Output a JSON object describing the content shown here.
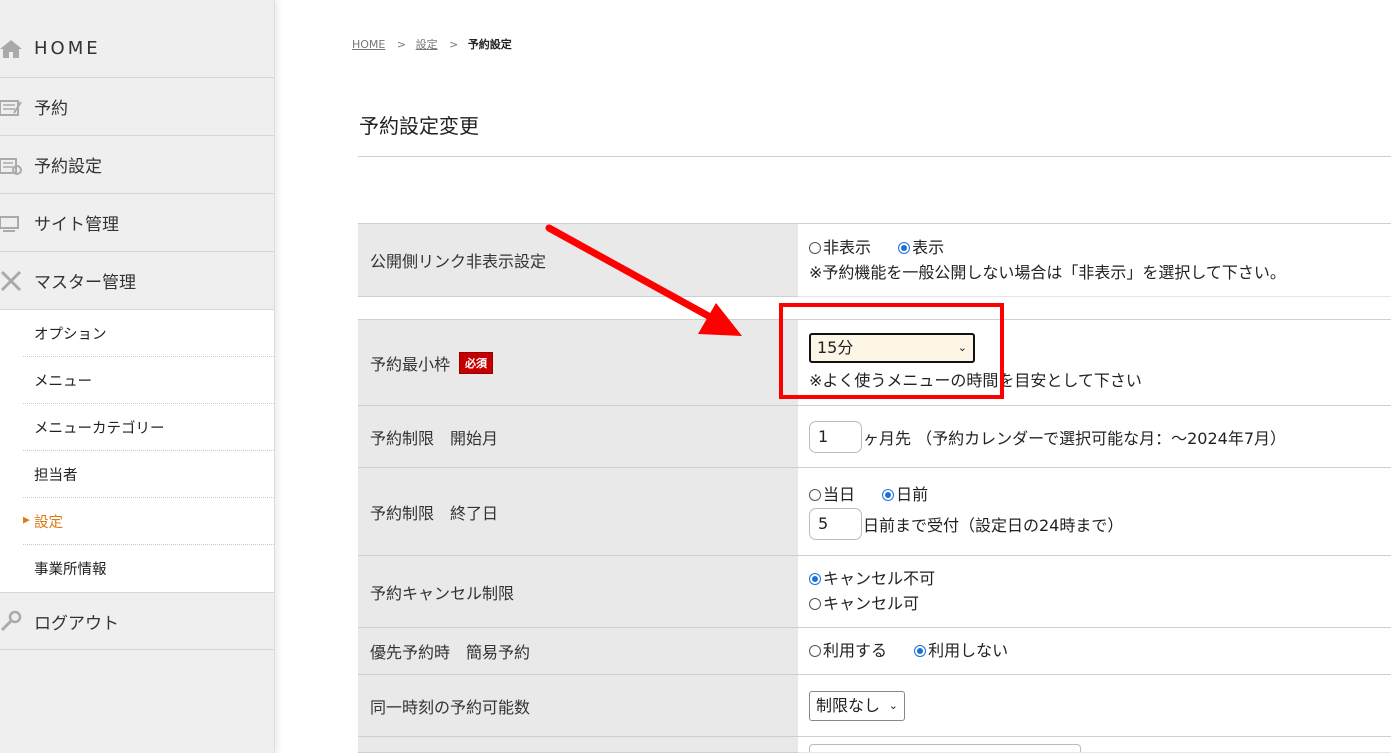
{
  "sidebar": {
    "home": "HOME",
    "items": [
      {
        "label": "予約"
      },
      {
        "label": "予約設定"
      },
      {
        "label": "サイト管理"
      },
      {
        "label": "マスター管理"
      }
    ],
    "submenu": [
      {
        "label": "オプション"
      },
      {
        "label": "メニュー"
      },
      {
        "label": "メニューカテゴリー"
      },
      {
        "label": "担当者"
      },
      {
        "label": "設定"
      },
      {
        "label": "事業所情報"
      }
    ],
    "logout": "ログアウト"
  },
  "breadcrumb": {
    "home": "HOME",
    "sep": ">",
    "settings": "設定",
    "current": "予約設定"
  },
  "page_title": "予約設定変更",
  "form": {
    "public_link": {
      "label": "公開側リンク非表示設定",
      "option_hide": "非表示",
      "option_show": "表示",
      "note": "※予約機能を一般公開しない場合は「非表示」を選択して下さい。"
    },
    "min_slot": {
      "label": "予約最小枠",
      "required": "必須",
      "value": "15分",
      "note": "※よく使うメニューの時間を目安として下さい"
    },
    "start_month": {
      "label": "予約制限　開始月",
      "value": "1",
      "suffix": "ヶ月先 （予約カレンダーで選択可能な月：～2024年7月）"
    },
    "end_day": {
      "label": "予約制限　終了日",
      "option_today": "当日",
      "option_days_before": "日前",
      "value": "5",
      "suffix": "日前まで受付（設定日の24時まで）"
    },
    "cancel": {
      "label": "予約キャンセル制限",
      "option_no": "キャンセル不可",
      "option_yes": "キャンセル可"
    },
    "priority": {
      "label": "優先予約時　簡易予約",
      "option_use": "利用する",
      "option_not_use": "利用しない"
    },
    "concurrent": {
      "label": "同一時刻の予約可能数",
      "value": "制限なし"
    }
  },
  "colors": {
    "accent": "#e07b17",
    "required_bg": "#c40000",
    "highlight": "#ff0000",
    "radio_on": "#1a6fd8"
  }
}
